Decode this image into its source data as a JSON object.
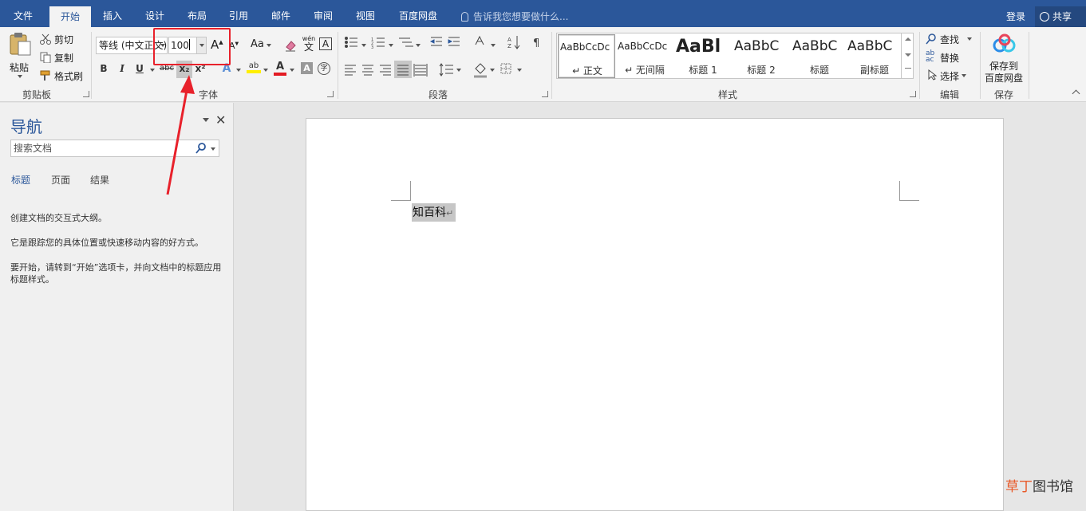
{
  "tabs": [
    {
      "label": "文件",
      "active": false
    },
    {
      "label": "开始",
      "active": true
    },
    {
      "label": "插入",
      "active": false
    },
    {
      "label": "设计",
      "active": false
    },
    {
      "label": "布局",
      "active": false
    },
    {
      "label": "引用",
      "active": false
    },
    {
      "label": "邮件",
      "active": false
    },
    {
      "label": "审阅",
      "active": false
    },
    {
      "label": "视图",
      "active": false
    },
    {
      "label": "百度网盘",
      "active": false
    }
  ],
  "tellme": "告诉我您想要做什么...",
  "login": "登录",
  "share": "共享",
  "clipboard": {
    "paste": "粘贴",
    "cut": "剪切",
    "copy": "复制",
    "format_painter": "格式刷",
    "label": "剪贴板"
  },
  "font": {
    "name": "等线 (中文正文)",
    "size": "100",
    "grow": "A",
    "aa": "Aa",
    "wen": "wén",
    "wen_char": "文",
    "boxA": "A",
    "bold": "B",
    "italic": "I",
    "underline": "U",
    "strike": "abc",
    "sub": "x₂",
    "sup": "x²",
    "effects": "A",
    "highlight": "ab",
    "color": "A",
    "shade": "A",
    "circle": "字",
    "label": "字体"
  },
  "paragraph": {
    "label": "段落"
  },
  "styles": {
    "label": "样式",
    "items": [
      {
        "sample": "AaBbCcDc",
        "name": "↵ 正文"
      },
      {
        "sample": "AaBbCcDc",
        "name": "↵ 无间隔"
      },
      {
        "sample": "AaBl",
        "name": "标题 1"
      },
      {
        "sample": "AaBbC",
        "name": "标题 2"
      },
      {
        "sample": "AaBbC",
        "name": "标题"
      },
      {
        "sample": "AaBbC",
        "name": "副标题"
      }
    ]
  },
  "editing": {
    "find": "查找",
    "replace": "替换",
    "select": "选择",
    "label": "编辑"
  },
  "save": {
    "line1": "保存到",
    "line2": "百度网盘",
    "label": "保存"
  },
  "nav": {
    "title": "导航",
    "search_placeholder": "搜索文档",
    "tabs": [
      "标题",
      "页面",
      "结果"
    ],
    "msg1": "创建文档的交互式大纲。",
    "msg2": "它是跟踪您的具体位置或快速移动内容的好方式。",
    "msg3": "要开始，请转到“开始”选项卡，并向文档中的标题应用标题样式。"
  },
  "document": {
    "text": "知百科",
    "para_mark": "↵"
  },
  "watermark": {
    "part1": "草丁",
    "part2": "图书馆"
  },
  "colors": {
    "brand": "#2b579a",
    "highlight_box": "#e8212b",
    "arrow": "#e8212b"
  }
}
